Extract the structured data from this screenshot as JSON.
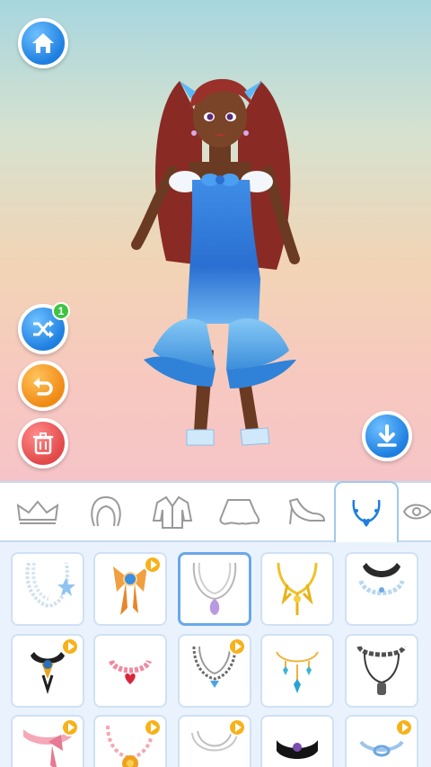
{
  "colors": {
    "accent_blue": "#1e7fe0",
    "accent_orange": "#f08a16",
    "accent_red": "#e24949",
    "badge_green": "#3ec443",
    "video_badge": "#f7b21a"
  },
  "buttons": {
    "home": {
      "icon": "home-icon"
    },
    "shuffle": {
      "icon": "shuffle-icon",
      "badge": "1"
    },
    "undo": {
      "icon": "undo-icon"
    },
    "delete": {
      "icon": "trash-icon"
    },
    "download": {
      "icon": "download-icon"
    }
  },
  "tabs": [
    {
      "icon": "crown-icon",
      "active": false
    },
    {
      "icon": "hair-icon",
      "active": false
    },
    {
      "icon": "jacket-icon",
      "active": false
    },
    {
      "icon": "skirt-icon",
      "active": false
    },
    {
      "icon": "shoe-icon",
      "active": false
    },
    {
      "icon": "necklace-icon",
      "active": true
    },
    {
      "icon": "eye-icon",
      "active": false
    }
  ],
  "items": [
    {
      "icon": "pearl-necklace-icon",
      "locked": false,
      "selected": false
    },
    {
      "icon": "bow-necklace-icon",
      "locked": true,
      "selected": false
    },
    {
      "icon": "chain-necklace-icon",
      "locked": false,
      "selected": true
    },
    {
      "icon": "gold-necklace-icon",
      "locked": false,
      "selected": false
    },
    {
      "icon": "choker-pearl-icon",
      "locked": false,
      "selected": false
    },
    {
      "icon": "black-choker-icon",
      "locked": true,
      "selected": false
    },
    {
      "icon": "heart-pendant-icon",
      "locked": false,
      "selected": false
    },
    {
      "icon": "silver-chain-icon",
      "locked": true,
      "selected": false
    },
    {
      "icon": "crystal-drop-icon",
      "locked": false,
      "selected": false
    },
    {
      "icon": "dark-chain-icon",
      "locked": false,
      "selected": false
    },
    {
      "icon": "pink-bow-icon",
      "locked": true,
      "selected": false
    },
    {
      "icon": "flower-necklace-icon",
      "locked": true,
      "selected": false
    },
    {
      "icon": "silver-layered-icon",
      "locked": true,
      "selected": false
    },
    {
      "icon": "dark-choker-icon",
      "locked": false,
      "selected": false
    },
    {
      "icon": "ring-choker-icon",
      "locked": true,
      "selected": false
    }
  ]
}
